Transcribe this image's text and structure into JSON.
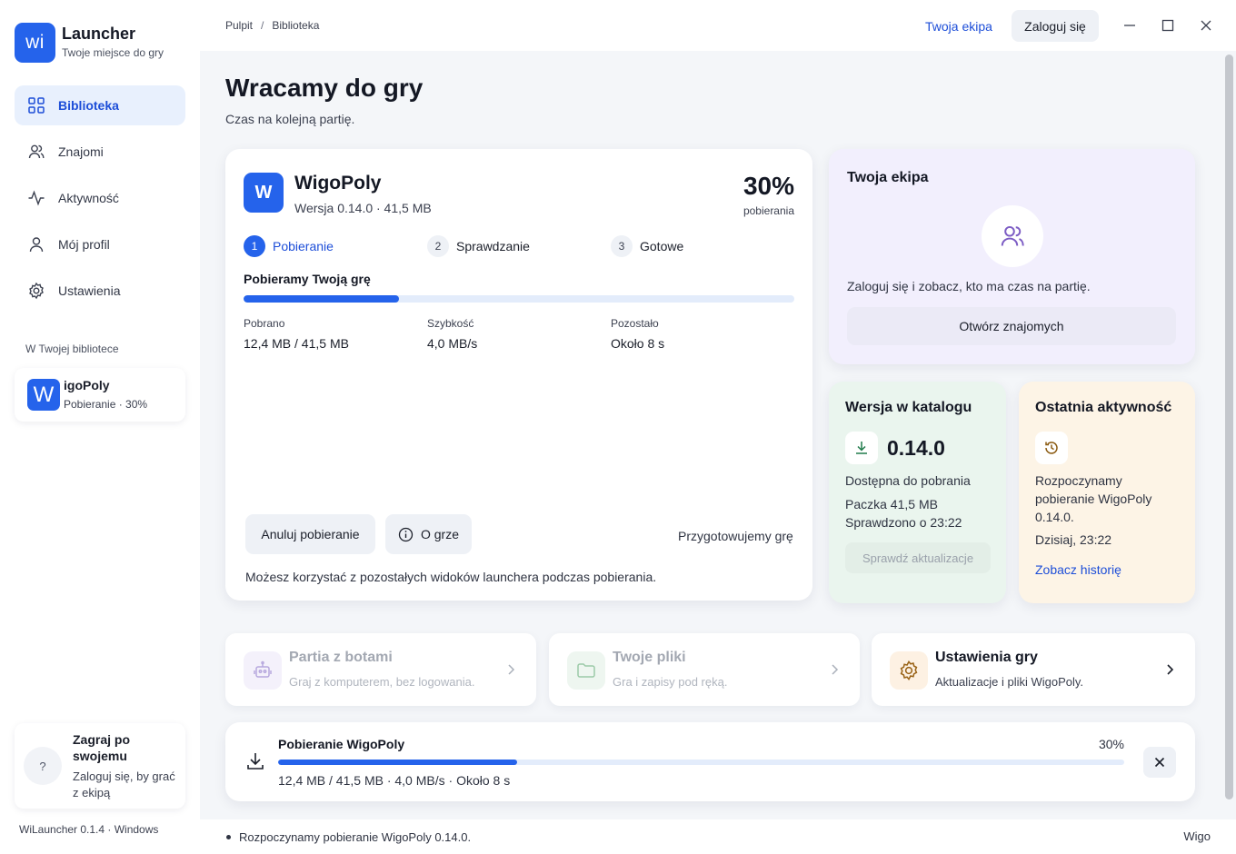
{
  "sidebar": {
    "logo_text": "wi",
    "app_name": "Launcher",
    "app_tagline": "Twoje miejsce do gry",
    "nav": [
      {
        "label": "Biblioteka",
        "icon": "grid-icon"
      },
      {
        "label": "Znajomi",
        "icon": "users-icon"
      },
      {
        "label": "Aktywność",
        "icon": "activity-icon"
      },
      {
        "label": "Mój profil",
        "icon": "user-icon"
      },
      {
        "label": "Ustawienia",
        "icon": "gear-icon"
      }
    ],
    "section_label": "W Twojej bibliotece",
    "library_item": {
      "icon_letter": "W",
      "name": "igoPoly",
      "status": "Pobieranie · 30%"
    },
    "help": {
      "symbol": "?",
      "title": "Zagraj po swojemu",
      "text": "Zaloguj się, by grać z ekipą"
    },
    "footer": "WiLauncher 0.1.4 · Windows"
  },
  "topbar": {
    "breadcrumb": [
      "Pulpit",
      "Biblioteka"
    ],
    "breadcrumb_sep": "/",
    "team_link": "Twoja ekipa",
    "login": "Zaloguj się"
  },
  "page": {
    "title": "Wracamy do gry",
    "subtitle": "Czas na kolejną partię."
  },
  "game": {
    "icon_letter": "W",
    "name": "WigoPoly",
    "version_line": "Wersja 0.14.0 · 41,5 MB",
    "percent": "30%",
    "percent_label": "pobierania",
    "progress": 0.3,
    "steps": [
      {
        "num": "1",
        "label": "Pobieranie"
      },
      {
        "num": "2",
        "label": "Sprawdzanie"
      },
      {
        "num": "3",
        "label": "Gotowe"
      }
    ],
    "progress_title": "Pobieramy Twoją grę",
    "stats": [
      {
        "label": "Pobrano",
        "value": "12,4 MB / 41,5 MB"
      },
      {
        "label": "Szybkość",
        "value": "4,0 MB/s"
      },
      {
        "label": "Pozostało",
        "value": "Około 8 s"
      }
    ],
    "cancel_btn": "Anuluj pobieranie",
    "about_btn": "O grze",
    "preparing": "Przygotowujemy grę",
    "note": "Możesz korzystać z pozostałych widoków launchera podczas pobierania."
  },
  "team": {
    "title": "Twoja ekipa",
    "text": "Zaloguj się i zobacz, kto ma czas na partię.",
    "button": "Otwórz znajomych"
  },
  "catalog": {
    "title": "Wersja w katalogu",
    "version": "0.14.0",
    "available": "Dostępna do pobrania",
    "package": "Paczka 41,5 MB",
    "checked": "Sprawdzono o 23:22",
    "button": "Sprawdź aktualizacje"
  },
  "activity": {
    "title": "Ostatnia aktywność",
    "text": "Rozpoczynamy pobieranie WigoPoly 0.14.0.",
    "time": "Dzisiaj, 23:22",
    "link": "Zobacz historię"
  },
  "tiles": [
    {
      "title": "Partia z botami",
      "desc": "Graj z komputerem, bez logowania."
    },
    {
      "title": "Twoje pliki",
      "desc": "Gra i zapisy pod ręką."
    },
    {
      "title": "Ustawienia gry",
      "desc": "Aktualizacje i pliki WigoPoly."
    }
  ],
  "download": {
    "title": "Pobieranie WigoPoly",
    "percent": "30%",
    "progress": 0.3,
    "info": "12,4 MB / 41,5 MB · 4,0 MB/s · Około 8 s"
  },
  "status": {
    "text": "Rozpoczynamy pobieranie WigoPoly 0.14.0.",
    "right": "Wigo"
  },
  "colors": {
    "accent": "#2563eb",
    "team_bg": "#f2effd",
    "catalog_bg": "#eaf5ee",
    "activity_bg": "#fdf4e6"
  }
}
